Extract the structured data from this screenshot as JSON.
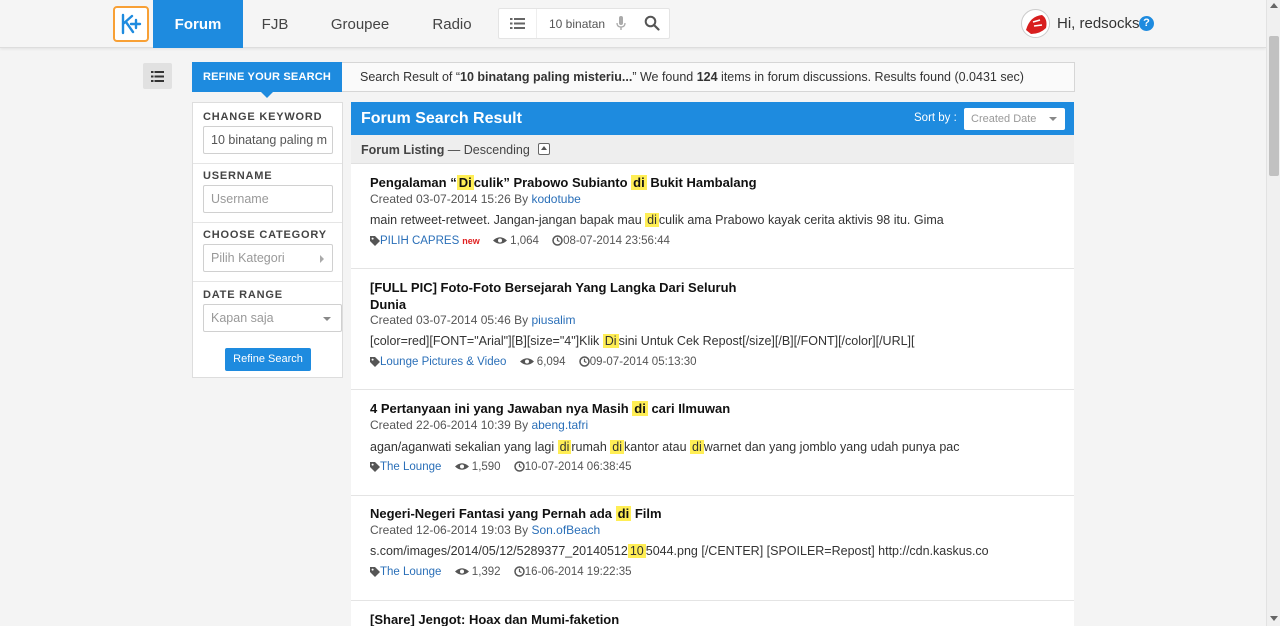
{
  "nav": {
    "items": [
      {
        "label": "Forum",
        "active": true
      },
      {
        "label": "FJB",
        "active": false
      },
      {
        "label": "Groupee",
        "active": false
      },
      {
        "label": "Radio",
        "active": false
      }
    ],
    "search_value": "10 binatan",
    "greeting": "Hi, redsocks",
    "help": "?"
  },
  "refine": {
    "tab_label": "REFINE YOUR SEARCH",
    "summary_prefix": "Search Result of “",
    "summary_query": "10 binatang paling misteriu...",
    "summary_mid": "” We found ",
    "summary_count": "124",
    "summary_suffix": " items in forum discussions. Results found (0.0431 sec)"
  },
  "filters": {
    "keyword_label": "CHANGE KEYWORD",
    "keyword_value": "10 binatang paling m",
    "username_label": "USERNAME",
    "username_placeholder": "Username",
    "category_label": "CHOOSE CATEGORY",
    "category_placeholder": "Pilih Kategori",
    "date_label": "DATE RANGE",
    "date_value": "Kapan saja",
    "refine_button": "Refine Search"
  },
  "results": {
    "title": "Forum Search Result",
    "sort_label": "Sort by :",
    "sort_value": "Created Date",
    "listing_label": "Forum Listing",
    "listing_order": " — Descending",
    "items": [
      {
        "title_parts": [
          "Pengalaman “",
          "Di",
          "culik” Prabowo Subianto ",
          "di",
          " Bukit Hambalang"
        ],
        "created": "Created 03-07-2014 15:26 By ",
        "author": "kodotube",
        "snippet_parts": [
          "main retweet-retweet. Jangan-jangan bapak mau ",
          "di",
          "culik ama Prabowo kayak cerita aktivis 98 itu. Gima"
        ],
        "category": "PILIH CAPRES",
        "badge": "new",
        "views": "1,064",
        "last_post": "08-07-2014 23:56:44"
      },
      {
        "title_line1": "[FULL PIC] Foto-Foto Bersejarah Yang Langka Dari Seluruh",
        "title_line2": "Dunia",
        "created": "Created 03-07-2014 05:46 By ",
        "author": "piusalim",
        "snippet_parts": [
          "[color=red][FONT=\"Arial\"][B][size=\"4\"]Klik ",
          "Di",
          "sini Untuk Cek Repost[/size][/B][/FONT][/color][/URL]["
        ],
        "category": "Lounge Pictures & Video",
        "views": "6,094",
        "last_post": "09-07-2014 05:13:30"
      },
      {
        "title_parts": [
          "4 Pertanyaan ini yang Jawaban nya Masih ",
          "di",
          " cari Ilmuwan"
        ],
        "created": "Created 22-06-2014 10:39 By ",
        "author": "abeng.tafri",
        "snippet_parts": [
          "agan/aganwati sekalian yang lagi ",
          "di",
          "rumah ",
          "di",
          "kantor atau ",
          "di",
          "warnet dan yang jomblo yang udah punya pac"
        ],
        "category": "The Lounge",
        "views": "1,590",
        "last_post": "10-07-2014 06:38:45"
      },
      {
        "title_parts": [
          "Negeri-Negeri Fantasi yang Pernah ada ",
          "di",
          " Film"
        ],
        "created": "Created 12-06-2014 19:03 By ",
        "author": "Son.ofBeach",
        "snippet_parts": [
          "s.com/images/2014/05/12/5289377_20140512",
          "10",
          "5044.png [/CENTER] [SPOILER=Repost] http://cdn.kaskus.co"
        ],
        "category": "The Lounge",
        "views": "1,392",
        "last_post": "16-06-2014 19:22:35"
      },
      {
        "title": "[Share] Jengot: Hoax dan Mumi-faketion"
      }
    ]
  },
  "colors": {
    "accent": "#1e8bdf",
    "logo_border": "#f8a035",
    "highlight": "#ffee55"
  }
}
